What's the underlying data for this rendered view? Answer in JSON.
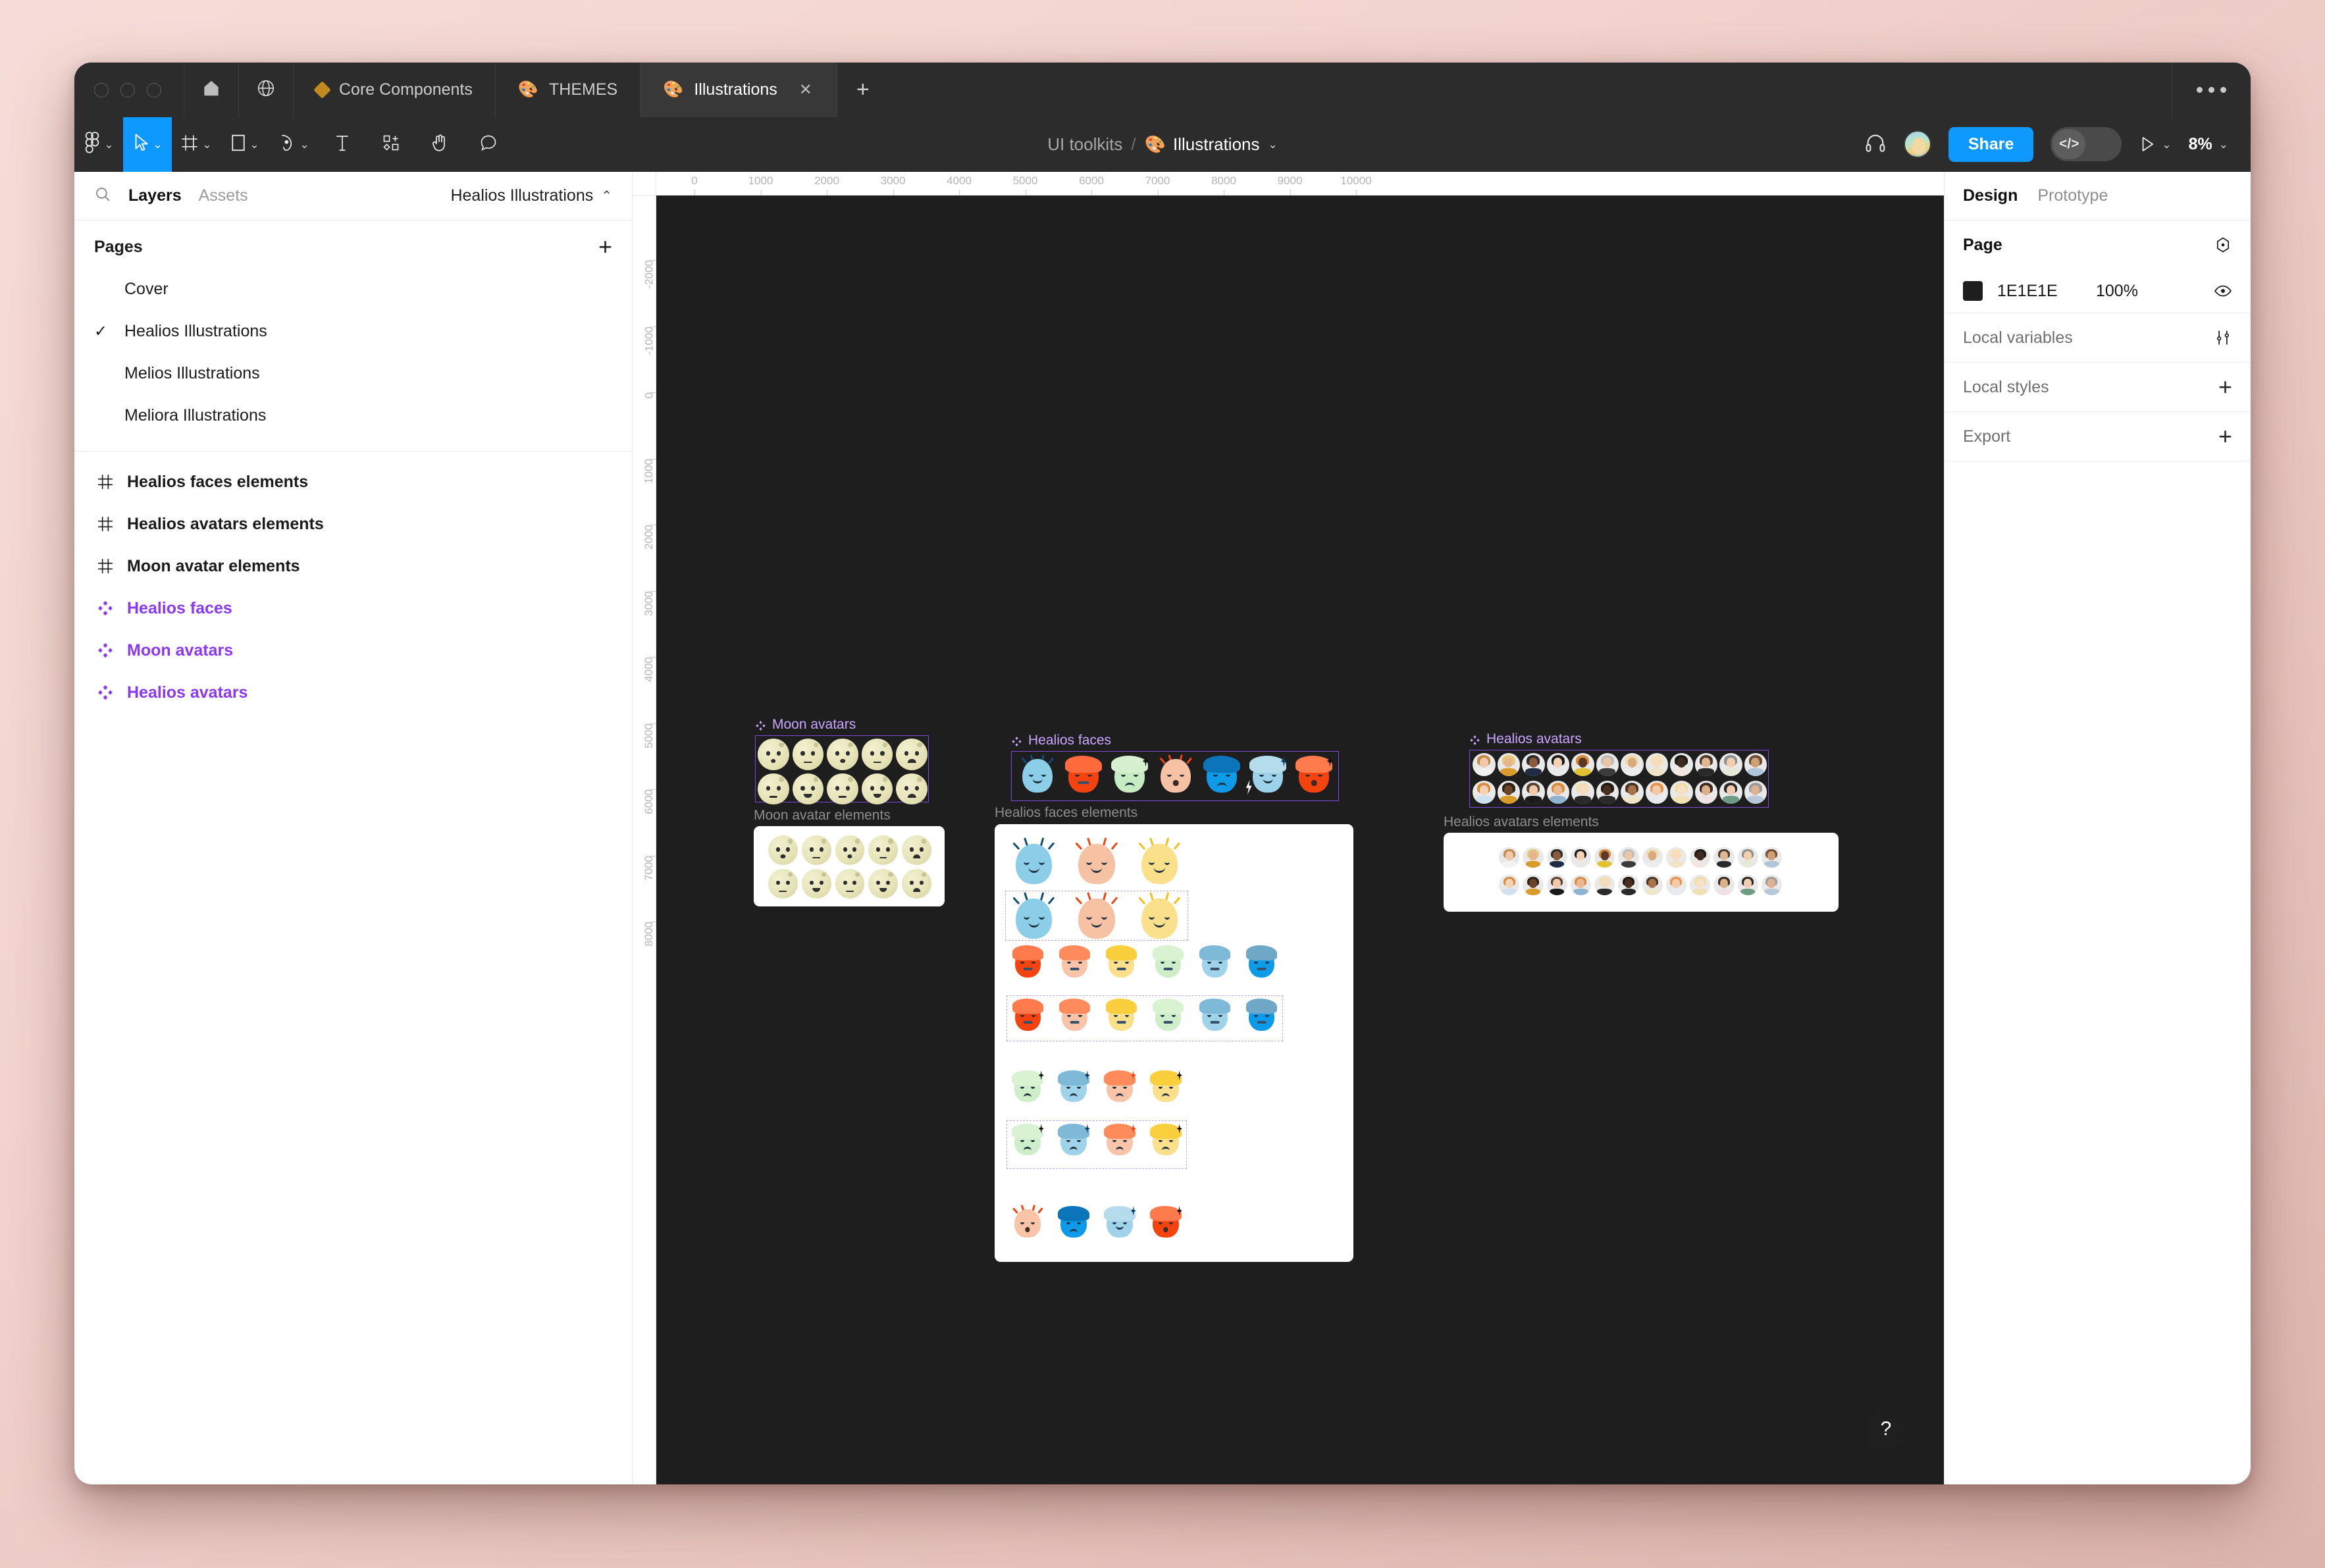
{
  "window": {
    "traffic_lights": [
      "close",
      "minimize",
      "maximize"
    ]
  },
  "tab_bar": {
    "home_icon": "home-icon",
    "globe_icon": "globe-icon",
    "tabs": [
      {
        "label": "Core Components",
        "icon": "diamond-icon",
        "active": false,
        "closable": false
      },
      {
        "label": "THEMES",
        "icon": "palette-emoji",
        "emoji": "🎨",
        "active": false,
        "closable": false
      },
      {
        "label": "Illustrations",
        "icon": "palette-emoji",
        "emoji": "🎨",
        "active": true,
        "closable": true,
        "close_glyph": "✕"
      }
    ],
    "add_tab_glyph": "+",
    "overflow_menu": "more-options"
  },
  "toolbar": {
    "tools": [
      {
        "name": "figma-menu",
        "caret": "⌄",
        "selected": false
      },
      {
        "name": "move-tool",
        "caret": "⌄",
        "selected": true
      },
      {
        "name": "frame-tool",
        "caret": "⌄",
        "selected": false
      },
      {
        "name": "shape-tool",
        "caret": "⌄",
        "selected": false
      },
      {
        "name": "pen-tool",
        "caret": "⌄",
        "selected": false
      },
      {
        "name": "text-tool",
        "caret": "",
        "selected": false
      },
      {
        "name": "resources-tool",
        "caret": "",
        "selected": false
      },
      {
        "name": "hand-tool",
        "caret": "",
        "selected": false
      },
      {
        "name": "comment-tool",
        "caret": "",
        "selected": false
      }
    ],
    "breadcrumb": {
      "project": "UI toolkits",
      "separator": "/",
      "file_emoji": "🎨",
      "file": "Illustrations",
      "caret": "⌄"
    },
    "right": {
      "headphones_icon": "headphones-icon",
      "avatar": "user-avatar",
      "share_label": "Share",
      "devmode_glyph": "</>",
      "present_caret": "⌄",
      "zoom_label": "8%",
      "zoom_caret": "⌄"
    }
  },
  "left_panel": {
    "search_icon": "search-icon",
    "tabs": [
      {
        "label": "Layers",
        "active": true
      },
      {
        "label": "Assets",
        "active": false
      }
    ],
    "file_name": "Healios Illustrations",
    "file_caret": "⌃",
    "pages_title": "Pages",
    "pages_add_glyph": "+",
    "pages": [
      {
        "label": "Cover",
        "selected": false
      },
      {
        "label": "Healios Illustrations",
        "selected": true,
        "check": "✓"
      },
      {
        "label": "Melios Illustrations",
        "selected": false
      },
      {
        "label": "Meliora Illustrations",
        "selected": false
      }
    ],
    "layers": [
      {
        "label": "Healios faces elements",
        "type": "frame"
      },
      {
        "label": "Healios avatars elements",
        "type": "frame"
      },
      {
        "label": "Moon avatar elements",
        "type": "frame"
      },
      {
        "label": "Healios faces",
        "type": "component"
      },
      {
        "label": "Moon avatars",
        "type": "component"
      },
      {
        "label": "Healios avatars",
        "type": "component"
      }
    ]
  },
  "canvas": {
    "ruler_top_ticks": [
      "0",
      "1000",
      "2000",
      "3000",
      "4000",
      "5000",
      "6000",
      "7000",
      "8000",
      "9000",
      "10000"
    ],
    "ruler_left_ticks": [
      "-2000",
      "-1000",
      "0",
      "1000",
      "2000",
      "3000",
      "4000",
      "5000",
      "6000",
      "7000",
      "8000"
    ],
    "frames": [
      {
        "name": "Moon avatars",
        "type": "component",
        "selected": true
      },
      {
        "name": "Moon avatar elements",
        "type": "frame",
        "selected": false
      },
      {
        "name": "Healios faces",
        "type": "component",
        "selected": true
      },
      {
        "name": "Healios faces elements",
        "type": "frame",
        "selected": false
      },
      {
        "name": "Healios avatars",
        "type": "component",
        "selected": true
      },
      {
        "name": "Healios avatars elements",
        "type": "frame",
        "selected": false
      }
    ],
    "help_glyph": "?"
  },
  "right_panel": {
    "tabs": [
      {
        "label": "Design",
        "active": true
      },
      {
        "label": "Prototype",
        "active": false
      }
    ],
    "page_section": {
      "title": "Page",
      "settings_icon": "page-settings-icon",
      "color_hex": "1E1E1E",
      "opacity": "100%",
      "visibility_icon": "eye-icon"
    },
    "local_variables": {
      "label": "Local variables",
      "icon": "sliders-icon"
    },
    "local_styles": {
      "label": "Local styles",
      "icon": "plus-icon",
      "glyph": "+"
    },
    "export": {
      "label": "Export",
      "icon": "plus-icon",
      "glyph": "+"
    }
  },
  "colors": {
    "accent_blue": "#0d99ff",
    "component_purple": "#8a38f5",
    "canvas_bg": "#1e1e1e",
    "chrome_bg": "#2c2c2c",
    "desktop_bg": "#efd0cb"
  }
}
